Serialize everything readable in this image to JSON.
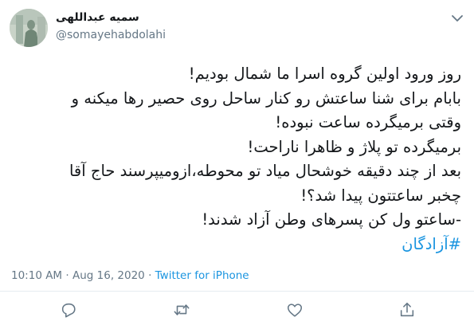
{
  "author": {
    "display_name": "سمیه عبداللهی",
    "handle": "@somayehabdolahi",
    "avatar_icon": "profile-photo"
  },
  "tweet": {
    "lines": [
      "روز ورود اولین گروه اسرا ما شمال بودیم!",
      "بابام برای شنا ساعتش رو کنار ساحل روی حصیر رها میکنه و",
      "وقتی برمیگرده ساعت نبوده!",
      "برمیگرده تو پلاژ و ظاهرا ناراحت!",
      "بعد از چند دقیقه خوشحال میاد تو محوطه،ازومیپرسند حاج آقا",
      "چخبر ساعتتون پیدا شد؟!",
      "-ساعتو ول کن پسرهای وطن آزاد شدند!"
    ],
    "hashtag": "#آزادگان"
  },
  "meta": {
    "time": "10:10 AM",
    "separator": "·",
    "date": "Aug 16, 2020",
    "source": "Twitter for iPhone"
  },
  "actions": [
    {
      "name": "reply-icon"
    },
    {
      "name": "retweet-icon"
    },
    {
      "name": "like-icon"
    },
    {
      "name": "share-icon"
    }
  ],
  "colors": {
    "accent": "#1b95e0",
    "secondary_text": "#657786",
    "icon": "#657786",
    "divider": "#e6ecf0"
  }
}
